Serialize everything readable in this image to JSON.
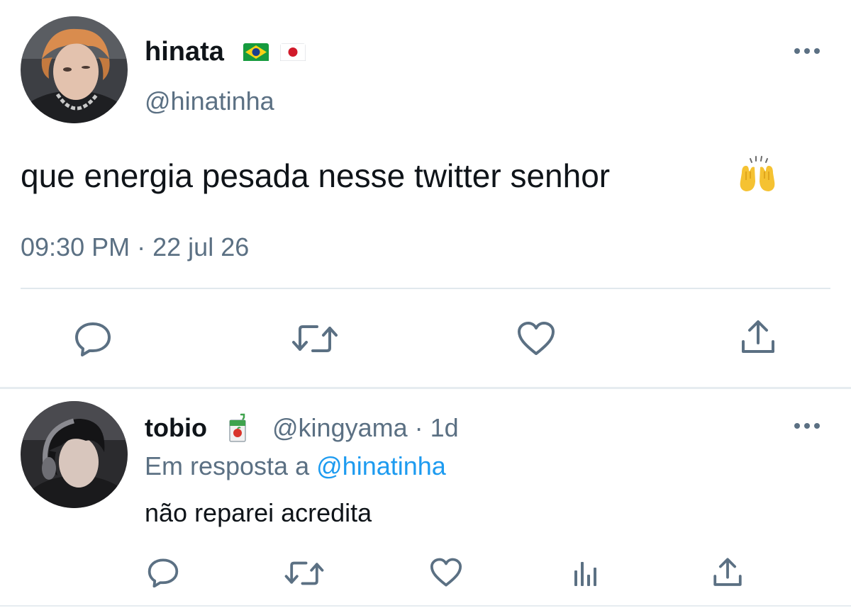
{
  "main_tweet": {
    "display_name": "hinata",
    "handle": "@hinatinha",
    "text": "que energia pesada nesse twitter senhor",
    "emoji": "🙌",
    "time": "09:30 PM",
    "separator": "·",
    "date": "22 jul 26",
    "flags": [
      "brazil-flag",
      "japan-flag"
    ],
    "actions": [
      "reply-icon",
      "retweet-icon",
      "like-icon",
      "share-icon"
    ]
  },
  "reply_tweet": {
    "display_name": "tobio",
    "handle": "@kingyama",
    "separator": "·",
    "age": "1d",
    "reply_prefix": "Em resposta a",
    "reply_to": "@hinatinha",
    "text": "não reparei acredita",
    "badge_icon": "juice-box-icon",
    "actions": [
      "reply-icon",
      "retweet-icon",
      "like-icon",
      "analytics-icon",
      "share-icon"
    ]
  },
  "colors": {
    "text": "#0f1419",
    "muted": "#5b7083",
    "link": "#1d9bf0",
    "divider": "#e1e8ed"
  }
}
